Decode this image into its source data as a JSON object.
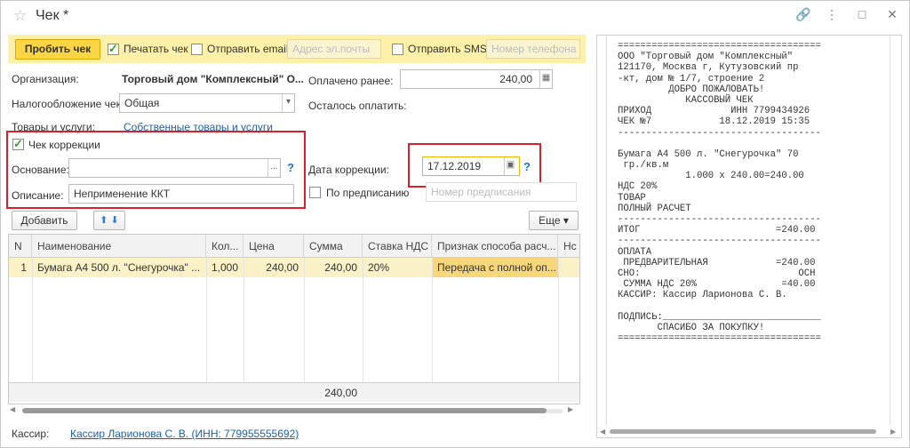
{
  "window": {
    "title": "Чек *"
  },
  "toolbar": {
    "punch_label": "Пробить чек",
    "print_label": "Печатать чек",
    "email_label": "Отправить email",
    "email_placeholder": "Адрес эл.почты",
    "sms_label": "Отправить SMS",
    "phone_placeholder": "Номер телефона"
  },
  "form": {
    "org_label": "Организация:",
    "org_value": "Торговый дом \"Комплексный\" О...",
    "paid_label": "Оплачено ранее:",
    "paid_value": "240,00",
    "tax_label": "Налогообложение чека:",
    "tax_value": "Общая",
    "remain_label": "Осталось оплатить:",
    "goods_label": "Товары и услуги:",
    "goods_link": "Собственные товары и услуги",
    "correction_label": "Чек коррекции",
    "reason_label": "Основание:",
    "reason_value": "",
    "reason_btn": "...",
    "help": "?",
    "desc_label": "Описание:",
    "desc_value": "Неприменение ККТ",
    "date_label": "Дата коррекции:",
    "date_value": "17.12.2019",
    "order_label": "По предписанию",
    "order_placeholder": "Номер предписания"
  },
  "buttons": {
    "add": "Добавить",
    "more": "Еще"
  },
  "table": {
    "headers": [
      "N",
      "Наименование",
      "Кол...",
      "Цена",
      "Сумма",
      "Ставка НДС",
      "Признак способа расч...",
      "Нс"
    ],
    "rows": [
      [
        "1",
        "Бумага А4 500 л. \"Снегурочка\" ...",
        "1,000",
        "240,00",
        "240,00",
        "20%",
        "Передача с полной оп...",
        ""
      ]
    ],
    "footer_sum": "240,00"
  },
  "cashier": {
    "label": "Кассир:",
    "value": "Кассир Ларионова С. В. (ИНН: 779955555692)"
  },
  "receipt": {
    "lines": [
      "====================================",
      "ООО \"Торговый дом \"Комплексный\"",
      "121170, Москва г, Кутузовский пр",
      "-кт, дом № 1/7, строение 2",
      "         ДОБРО ПОЖАЛОВАТЬ!",
      "            КАССОВЫЙ ЧЕК",
      "ПРИХОД              ИНН 7799434926",
      "ЧЕК №7            18.12.2019 15:35",
      "------------------------------------",
      "",
      "Бумага А4 500 л. \"Снегурочка\" 70",
      " гр./кв.м",
      "            1.000 x 240.00=240.00",
      "НДС 20%",
      "ТОВАР",
      "ПОЛНЫЙ РАСЧЕТ",
      "------------------------------------",
      "ИТОГ                        =240.00",
      "------------------------------------",
      "ОПЛАТА",
      " ПРЕДВАРИТЕЛЬНАЯ            =240.00",
      "СНО:                            ОСН",
      " СУММА НДС 20%               =40.00",
      "КАССИР: Кассир Ларионова С. В.",
      "",
      "ПОДПИСЬ:____________________________",
      "       СПАСИБО ЗА ПОКУПКУ!",
      "===================================="
    ]
  }
}
